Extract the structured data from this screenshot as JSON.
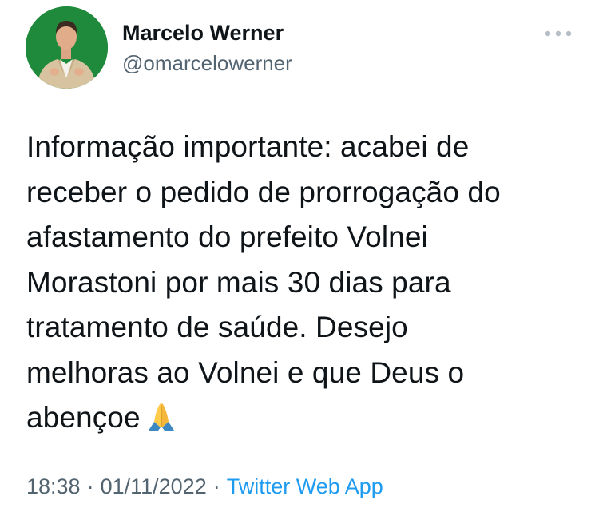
{
  "author": {
    "display_name": "Marcelo Werner",
    "handle": "@omarcelowerner"
  },
  "more_icon": "more-horizontal-icon",
  "tweet": {
    "text": "Informação importante: acabei de\nreceber o pedido de prorrogação do\nafastamento do prefeito Volnei\nMorastoni por mais 30 dias para\ntratamento de saúde. Desejo\nmelhoras ao Volnei e que Deus o\nabençoe",
    "emoji": "folded-hands-emoji"
  },
  "meta": {
    "time": "18:38",
    "separator": "·",
    "date": "01/11/2022",
    "source": "Twitter Web App"
  },
  "colors": {
    "text": "#0f1419",
    "secondary": "#536471",
    "link": "#1d9bf0",
    "avatar_background": "#1f8a3c"
  }
}
